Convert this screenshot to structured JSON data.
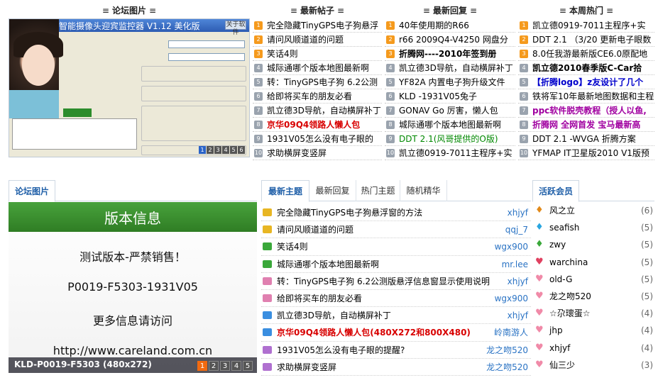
{
  "top": {
    "headers": {
      "forum_pics": "论坛图片",
      "latest_posts": "最新帖子",
      "latest_replies": "最新回复",
      "weekly_hot": "本周热门"
    },
    "pic": {
      "window_title": "智能摄像头迎宾监控器 V1.12 美化版",
      "close_label": "关于软件",
      "slides": [
        "1",
        "2",
        "3",
        "4",
        "5",
        "6"
      ]
    },
    "latest_posts": [
      {
        "n": "1",
        "text": "完全隐藏TinyGPS电子狗悬浮",
        "style": ""
      },
      {
        "n": "2",
        "text": "请问风顺道道的问题",
        "style": ""
      },
      {
        "n": "3",
        "text": "笑话4则",
        "style": ""
      },
      {
        "n": "4",
        "text": "城际通哪个版本地图最新啊",
        "style": ""
      },
      {
        "n": "5",
        "text": "转：TinyGPS电子狗 6.2公测",
        "style": ""
      },
      {
        "n": "6",
        "text": "给即将买车的朋友必看",
        "style": ""
      },
      {
        "n": "7",
        "text": "凯立德3D导航，自动横屏补丁",
        "style": ""
      },
      {
        "n": "8",
        "text": "京华09Q4领路人懒人包",
        "style": "red-b"
      },
      {
        "n": "9",
        "text": "1931V05怎么没有电子眼的",
        "style": ""
      },
      {
        "n": "10",
        "text": "求助横屏变竖屏",
        "style": ""
      }
    ],
    "latest_replies": [
      {
        "n": "1",
        "text": "40年使用期的R66",
        "style": ""
      },
      {
        "n": "2",
        "text": "r66 2009Q4-V4250 网盘分",
        "style": ""
      },
      {
        "n": "3",
        "text": "折腾网----2010年签到册",
        "style": "bold"
      },
      {
        "n": "4",
        "text": "凯立德3D导航，自动横屏补丁",
        "style": ""
      },
      {
        "n": "5",
        "text": "YF82A 内置电子狗升级文件",
        "style": ""
      },
      {
        "n": "6",
        "text": "KLD -1931V05兔子",
        "style": ""
      },
      {
        "n": "7",
        "text": "GONAV Go 厉害，懒人包",
        "style": ""
      },
      {
        "n": "8",
        "text": "城际通哪个版本地图最新啊",
        "style": ""
      },
      {
        "n": "9",
        "text": "DDT 2.1(风哥提供的O版)",
        "style": "green-t"
      },
      {
        "n": "10",
        "text": "凯立德0919-7011主程序+实",
        "style": ""
      }
    ],
    "weekly_hot": [
      {
        "n": "1",
        "text": "凯立德0919-7011主程序+实",
        "style": ""
      },
      {
        "n": "2",
        "text": "DDT 2.1 （3/20 更新电子眼数",
        "style": ""
      },
      {
        "n": "3",
        "text": "8.0任我游最新版CE6.0原配地",
        "style": ""
      },
      {
        "n": "4",
        "text": "凯立德2010春季版C-Car拾",
        "style": "bold"
      },
      {
        "n": "5",
        "text": "【折腾logo】z友设计了几个",
        "style": "blue-b"
      },
      {
        "n": "6",
        "text": "铁将军10年最新地图数据和主程",
        "style": ""
      },
      {
        "n": "7",
        "text": "ppc软件脱壳教程（授人以鱼,",
        "style": "purple-b"
      },
      {
        "n": "8",
        "text": "折腾网 全网首发 宝马最新高",
        "style": "purple-b"
      },
      {
        "n": "9",
        "text": "DDT 2.1 -WVGA 折腾方案",
        "style": ""
      },
      {
        "n": "10",
        "text": "YFMAP IT卫星版2010 V1版预",
        "style": ""
      }
    ]
  },
  "forum_pic": {
    "tab_label": "论坛图片",
    "slide_title": "版本信息",
    "slide_lines": [
      "测试版本-严禁销售！",
      "P0019-F5303-1931V05",
      "更多信息请访问",
      "http://www.careland.com.cn"
    ],
    "caption": "KLD-P0019-F5303 (480x272)",
    "pager": [
      "1",
      "2",
      "3",
      "4",
      "5"
    ]
  },
  "threads": {
    "tabs": [
      "最新主题",
      "最新回复",
      "热门主题",
      "随机精华"
    ],
    "rows": [
      {
        "title": "完全隐藏TinyGPS电子狗悬浮窗的方法",
        "author": "xhjyf",
        "icon": "#e8b623",
        "style": ""
      },
      {
        "title": "请问风顺道道的问题",
        "author": "qqj_7",
        "icon": "#e8b623",
        "style": ""
      },
      {
        "title": "笑话4则",
        "author": "wgx900",
        "icon": "#3aa83a",
        "style": ""
      },
      {
        "title": "城际通哪个版本地图最新啊",
        "author": "mr.lee",
        "icon": "#3aa83a",
        "style": ""
      },
      {
        "title": "转：TinyGPS电子狗 6.2公测版悬浮信息窗显示使用说明",
        "author": "xhjyf",
        "icon": "#e080b0",
        "style": ""
      },
      {
        "title": "给即将买车的朋友必看",
        "author": "wgx900",
        "icon": "#e080b0",
        "style": ""
      },
      {
        "title": "凯立德3D导航，自动横屏补丁",
        "author": "xhjyf",
        "icon": "#3a8ee0",
        "style": ""
      },
      {
        "title": "京华09Q4领路人懒人包(480X272和800X480)",
        "author": "岭南游人",
        "icon": "#3a8ee0",
        "style": "red-b"
      },
      {
        "title": "1931V05怎么没有电子眼的提醒?",
        "author": "龙之吻520",
        "icon": "#b070d0",
        "style": ""
      },
      {
        "title": "求助横屏变竖屏",
        "author": "龙之吻520",
        "icon": "#b070d0",
        "style": ""
      }
    ]
  },
  "members": {
    "tab_label": "活跃会员",
    "rows": [
      {
        "name": "风之立",
        "count": "(6)",
        "icon": "♦",
        "color": "#e28a1a"
      },
      {
        "name": "seafish",
        "count": "(5)",
        "icon": "♦",
        "color": "#2aa6e0"
      },
      {
        "name": "zwy",
        "count": "(5)",
        "icon": "♦",
        "color": "#3aa83a"
      },
      {
        "name": "warchina",
        "count": "(5)",
        "icon": "♥",
        "color": "#e04060"
      },
      {
        "name": "old-G",
        "count": "(5)",
        "icon": "♥",
        "color": "#f08aa8"
      },
      {
        "name": "龙之吻520",
        "count": "(5)",
        "icon": "♥",
        "color": "#f08aa8"
      },
      {
        "name": "☆尕瓌蛋☆",
        "count": "(4)",
        "icon": "♥",
        "color": "#f08aa8"
      },
      {
        "name": "jhp",
        "count": "(4)",
        "icon": "♥",
        "color": "#f08aa8"
      },
      {
        "name": "xhjyf",
        "count": "(4)",
        "icon": "♥",
        "color": "#f08aa8"
      },
      {
        "name": "仙三少",
        "count": "(3)",
        "icon": "♥",
        "color": "#f08aa8"
      }
    ]
  }
}
